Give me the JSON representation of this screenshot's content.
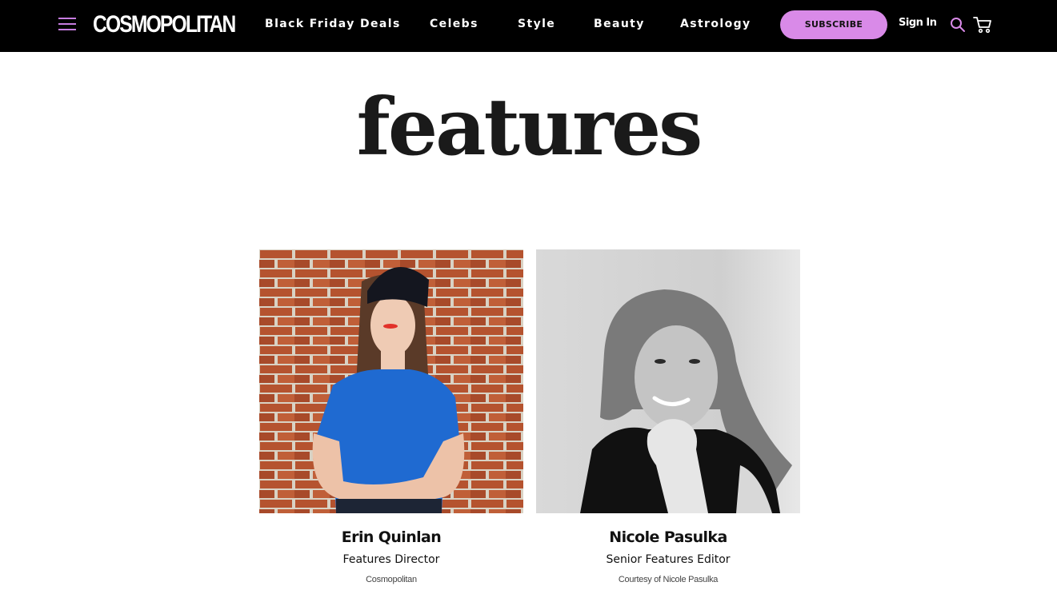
{
  "header": {
    "logo": "COSMOPOLITAN",
    "nav": [
      "Black Friday Deals",
      "Celebs",
      "Style",
      "Beauty",
      "Astrology"
    ],
    "subscribe_label": "SUBSCRIBE",
    "signin_label": "Sign In",
    "icons": [
      "menu-icon",
      "search-icon",
      "cart-icon"
    ],
    "colors": {
      "background": "#000000",
      "accent": "#d98ae8"
    }
  },
  "page": {
    "title": "features"
  },
  "people": [
    {
      "name": "Erin Quinlan",
      "role": "Features Director",
      "credit": "Cosmopolitan"
    },
    {
      "name": "Nicole Pasulka",
      "role": "Senior Features Editor",
      "credit": "Courtesy of Nicole Pasulka"
    }
  ]
}
